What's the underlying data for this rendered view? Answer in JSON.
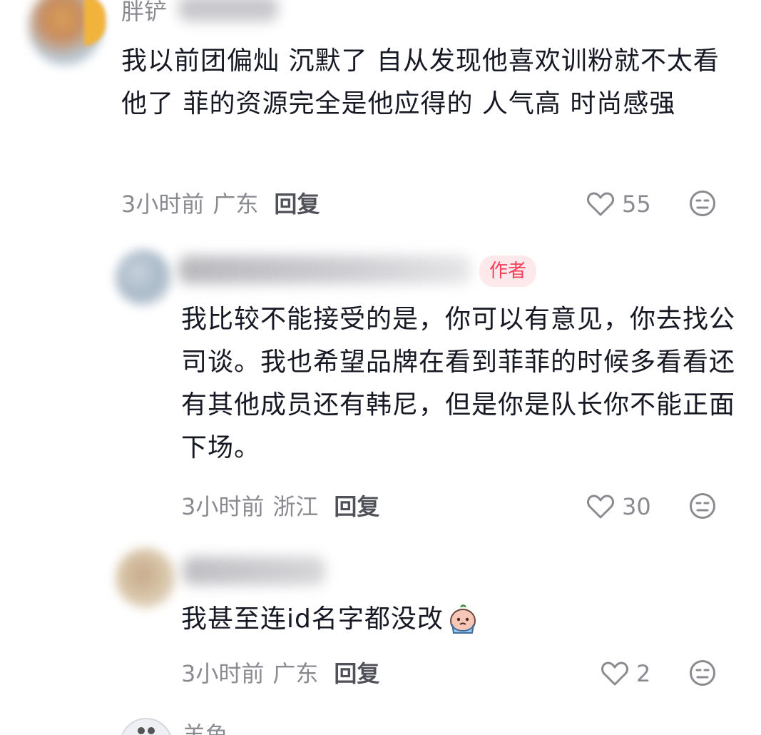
{
  "comments": [
    {
      "name_visible": "胖铲",
      "text": "我以前团偏灿 沉默了 自从发现他喜欢训粉就不太看他了 菲的资源完全是他应得的 人气高 时尚感强",
      "time": "3小时前",
      "location": "广东",
      "reply_label": "回复",
      "likes": "55"
    },
    {
      "author_badge": "作者",
      "text": "我比较不能接受的是，你可以有意见，你去找公司谈。我也希望品牌在看到菲菲的时候多看看还有其他成员还有韩尼，但是你是队长你不能正面下场。",
      "time": "3小时前",
      "location": "浙江",
      "reply_label": "回复",
      "likes": "30"
    },
    {
      "text": "我甚至连id名字都没改",
      "time": "3小时前",
      "location": "广东",
      "reply_label": "回复",
      "likes": "2"
    },
    {
      "name_visible": "羊鱼"
    }
  ]
}
